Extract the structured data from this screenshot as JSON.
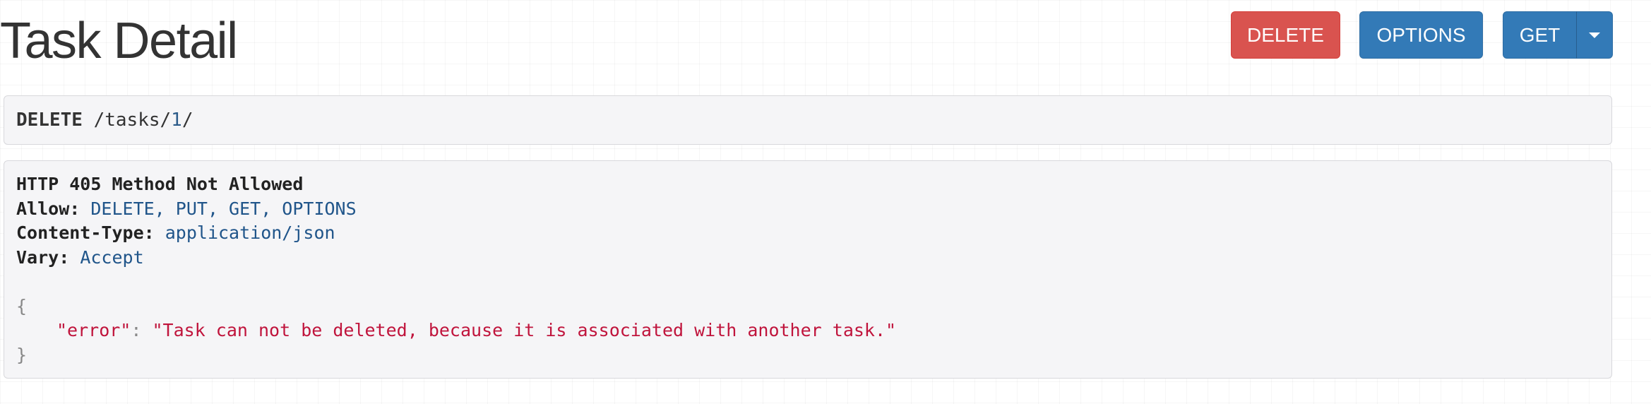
{
  "page": {
    "title": "Task Detail"
  },
  "buttons": {
    "delete_label": "DELETE",
    "options_label": "OPTIONS",
    "get_label": "GET",
    "get_dropdown_icon": "caret-down-icon"
  },
  "request": {
    "method": "DELETE",
    "path_prefix": "/tasks/",
    "id": "1",
    "path_suffix": "/"
  },
  "response": {
    "status_line": "HTTP 405 Method Not Allowed",
    "headers": [
      {
        "key": "Allow:",
        "value": "DELETE, PUT, GET, OPTIONS"
      },
      {
        "key": "Content-Type:",
        "value": "application/json"
      },
      {
        "key": "Vary:",
        "value": "Accept"
      }
    ],
    "body": {
      "open_brace": "{",
      "key": "\"error\"",
      "colon": ":",
      "value": "\"Task can not be deleted, because it is associated with another task.\"",
      "close_brace": "}"
    }
  },
  "colors": {
    "danger": "#d9534f",
    "primary": "#337ab7",
    "json_string": "#c0143c",
    "header_value": "#20558a",
    "panel_bg": "#f5f5f7"
  }
}
